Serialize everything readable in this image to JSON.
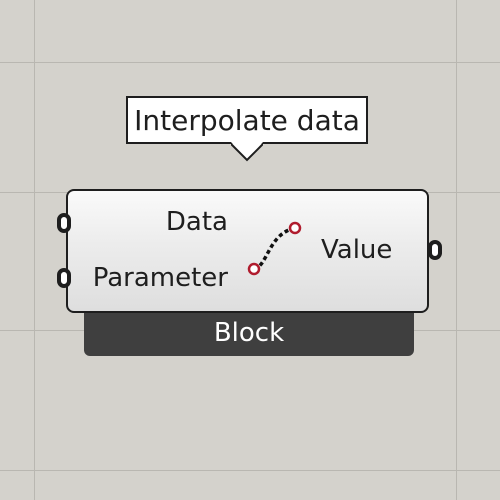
{
  "tooltip": {
    "text": "Interpolate data"
  },
  "component": {
    "inputs": [
      {
        "label": "Data"
      },
      {
        "label": "Parameter"
      }
    ],
    "outputs": [
      {
        "label": "Value"
      }
    ],
    "icon": "interpolation-curve-icon",
    "category_label": "Block"
  },
  "colors": {
    "canvas_background": "#d4d2cc",
    "grid_line": "#b9b7b1",
    "component_border": "#1e1e1e",
    "footer_background": "#3f3f3f",
    "icon_endpoint": "#b01c2e"
  }
}
